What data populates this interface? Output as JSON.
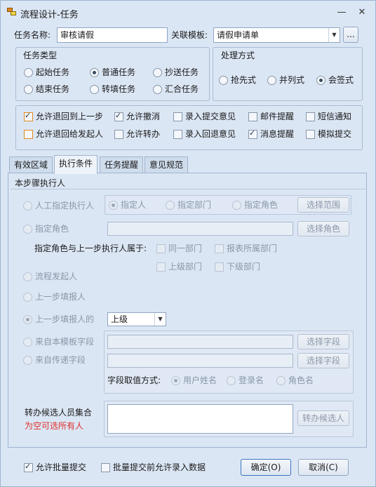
{
  "window": {
    "title": "流程设计-任务",
    "minimize": "—",
    "close": "✕"
  },
  "task_name": {
    "label": "任务名称:",
    "value": "审核请假"
  },
  "template": {
    "label": "关联模板:",
    "value": "请假申请单",
    "browse": "..."
  },
  "task_type": {
    "title": "任务类型",
    "options": [
      "起始任务",
      "普通任务",
      "抄送任务",
      "结束任务",
      "转填任务",
      "汇合任务"
    ],
    "selected": "普通任务"
  },
  "process_mode": {
    "title": "处理方式",
    "options": [
      "抢先式",
      "并列式",
      "会签式"
    ],
    "selected": "会签式"
  },
  "options": {
    "row1": [
      {
        "label": "允许退回到上一步",
        "checked": true
      },
      {
        "label": "允许撤消",
        "checked": true
      },
      {
        "label": "录入提交意见",
        "checked": false
      },
      {
        "label": "邮件提醒",
        "checked": false
      },
      {
        "label": "短信通知",
        "checked": false
      }
    ],
    "row2": [
      {
        "label": "允许退回给发起人",
        "checked": false
      },
      {
        "label": "允许转办",
        "checked": false
      },
      {
        "label": "录入回退意见",
        "checked": false
      },
      {
        "label": "消息提醒",
        "checked": true
      },
      {
        "label": "模拟提交",
        "checked": false
      }
    ]
  },
  "tabs": [
    "有效区域",
    "执行条件",
    "任务提醒",
    "意见规范"
  ],
  "active_tab": "执行条件",
  "executor": {
    "section_title": "本步骤执行人",
    "manual": {
      "label": "人工指定执行人",
      "choices": [
        "指定人",
        "指定部门",
        "指定角色"
      ],
      "choice_selected": "指定人",
      "button": "选择范围"
    },
    "role": {
      "label": "指定角色",
      "value": "",
      "button": "选择角色"
    },
    "relation": {
      "label": "指定角色与上一步执行人属于:",
      "checks": [
        "同一部门",
        "报表所属部门",
        "上级部门",
        "下级部门"
      ]
    },
    "initiator": {
      "label": "流程发起人"
    },
    "prev_filler": {
      "label": "上一步填报人"
    },
    "prev_filler_of": {
      "label": "上一步填报人的",
      "value": "上级"
    },
    "template_field": {
      "label": "来自本模板字段",
      "value": "",
      "button": "选择字段"
    },
    "passed_field": {
      "label": "来自传递字段",
      "value": "",
      "button": "选择字段"
    },
    "field_mode": {
      "label": "字段取值方式:",
      "choices": [
        "用户姓名",
        "登录名",
        "角色名"
      ],
      "choice_selected": "用户姓名"
    },
    "selected": "上一步填报人的",
    "candidates": {
      "label": "转办候选人员集合",
      "hint": "为空可选所有人",
      "button": "转办候选人",
      "value": ""
    }
  },
  "footer": {
    "batch_submit": {
      "label": "允许批量提交",
      "checked": true
    },
    "batch_input": {
      "label": "批量提交前允许录入数据",
      "checked": false
    },
    "ok": "确定(O)",
    "cancel": "取消(C)"
  },
  "colors": {
    "background": "#dbe6f4",
    "border": "#9fb4cf",
    "hint": "#e0302a"
  }
}
